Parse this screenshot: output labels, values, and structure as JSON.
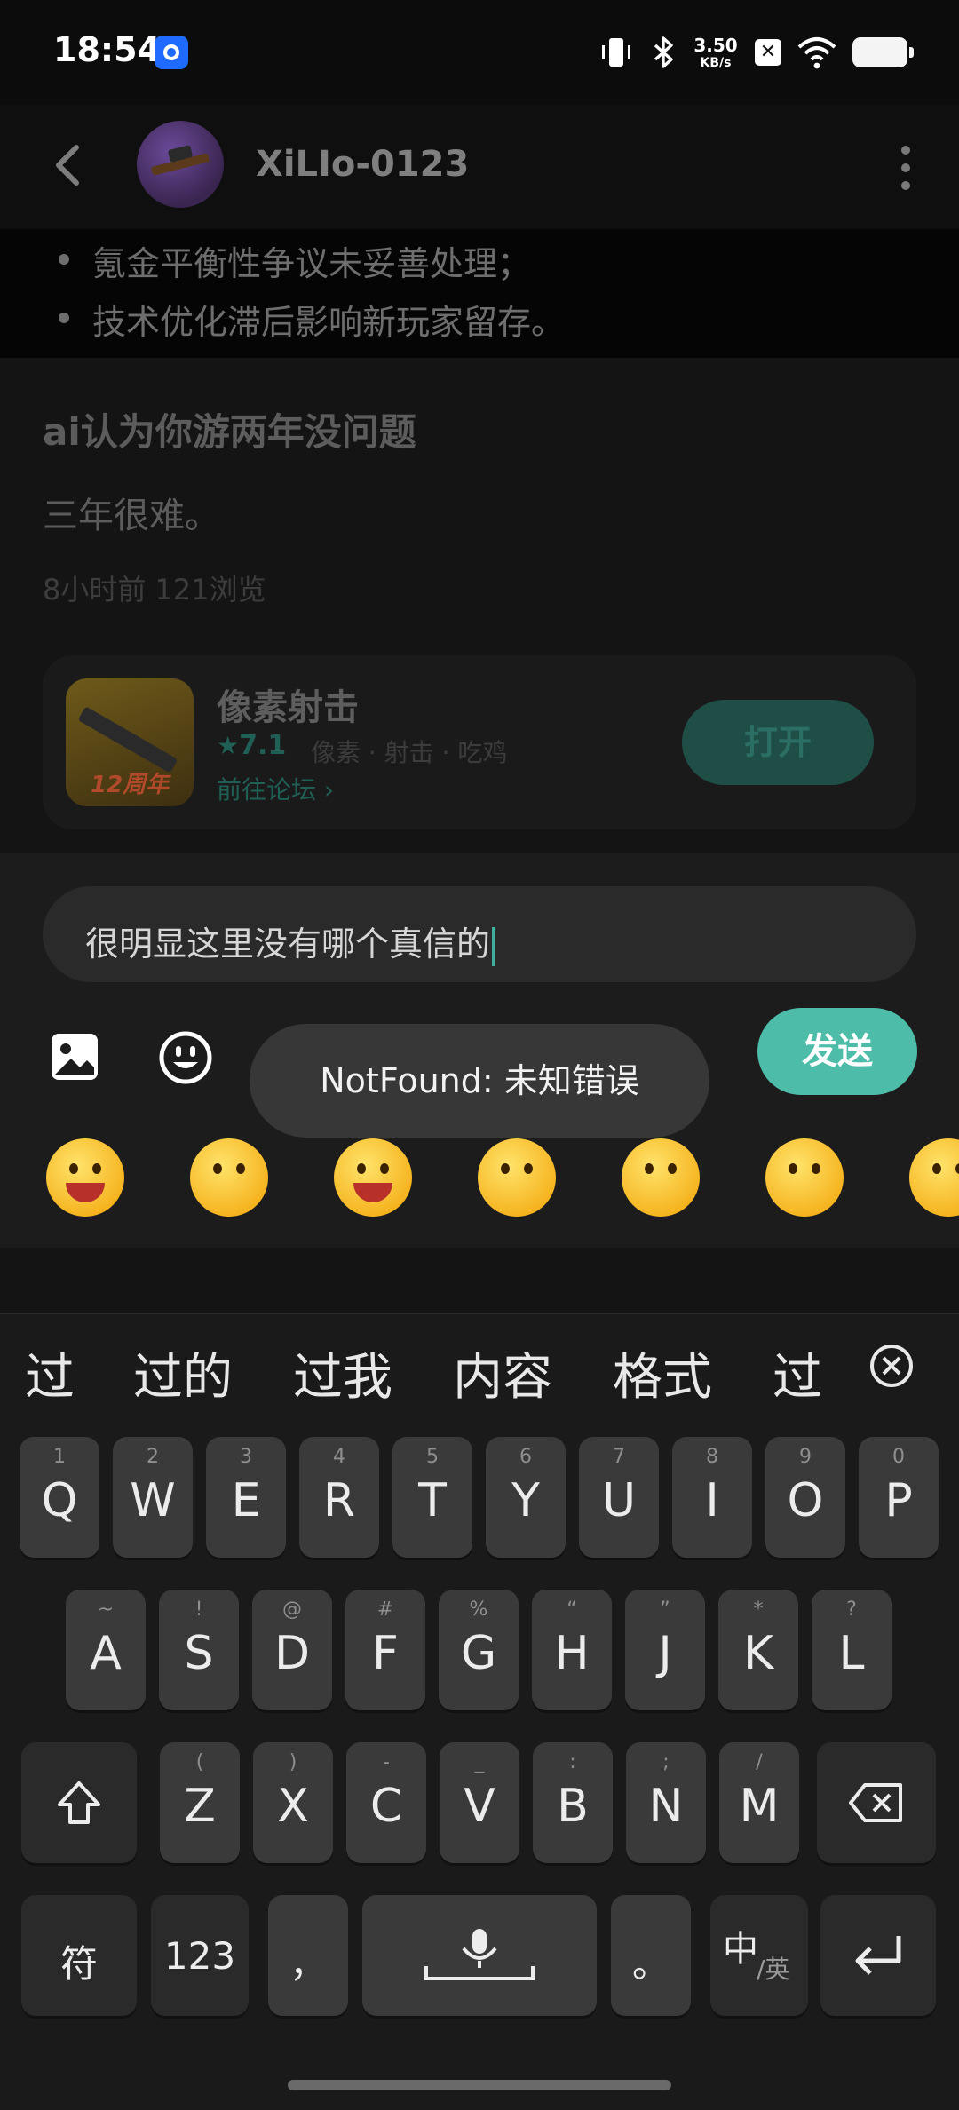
{
  "status_bar": {
    "time": "18:54",
    "net_speed_value": "3.50",
    "net_speed_unit": "KB/s",
    "icons": [
      "app-notification-icon",
      "vibrate-icon",
      "bluetooth-icon",
      "no-sim-icon",
      "wifi-icon",
      "battery-icon"
    ]
  },
  "header": {
    "username": "XiLIo-0123",
    "icons": [
      "back-arrow-icon",
      "avatar",
      "more-vertical-icon"
    ]
  },
  "post": {
    "bullets": [
      "氪金平衡性争议未妥善处理；",
      "技术优化滞后影响新玩家留存。"
    ],
    "title": "ai认为你游两年没问题",
    "body": "三年很难。",
    "meta": "8小时前  121浏览"
  },
  "game_card": {
    "name": "像素射击",
    "rating": "7.1",
    "tags": "像素 · 射击 · 吃鸡",
    "forum_link": "前往论坛",
    "open_label": "打开",
    "icon_badge": "12周年"
  },
  "comment": {
    "text": "很明显这里没有哪个真信的",
    "send_label": "发送",
    "toast": "NotFound: 未知错误",
    "emoji_count_visible": 7
  },
  "keyboard": {
    "candidates": [
      "过",
      "过的",
      "过我",
      "内容",
      "格式",
      "过"
    ],
    "row1": [
      {
        "k": "Q",
        "h": "1"
      },
      {
        "k": "W",
        "h": "2"
      },
      {
        "k": "E",
        "h": "3"
      },
      {
        "k": "R",
        "h": "4"
      },
      {
        "k": "T",
        "h": "5"
      },
      {
        "k": "Y",
        "h": "6"
      },
      {
        "k": "U",
        "h": "7"
      },
      {
        "k": "I",
        "h": "8"
      },
      {
        "k": "O",
        "h": "9"
      },
      {
        "k": "P",
        "h": "0"
      }
    ],
    "row2": [
      {
        "k": "A",
        "h": "~"
      },
      {
        "k": "S",
        "h": "!"
      },
      {
        "k": "D",
        "h": "@"
      },
      {
        "k": "F",
        "h": "#"
      },
      {
        "k": "G",
        "h": "%"
      },
      {
        "k": "H",
        "h": "“"
      },
      {
        "k": "J",
        "h": "”"
      },
      {
        "k": "K",
        "h": "*"
      },
      {
        "k": "L",
        "h": "?"
      }
    ],
    "row3": [
      {
        "k": "Z",
        "h": "("
      },
      {
        "k": "X",
        "h": ")"
      },
      {
        "k": "C",
        "h": "-"
      },
      {
        "k": "V",
        "h": "_"
      },
      {
        "k": "B",
        "h": ":"
      },
      {
        "k": "N",
        "h": ";"
      },
      {
        "k": "M",
        "h": "/"
      }
    ],
    "symbol_label": "符",
    "num_label": "123",
    "comma_label": "，",
    "period_label": "。",
    "lang_main": "中",
    "lang_sub": "/英"
  }
}
